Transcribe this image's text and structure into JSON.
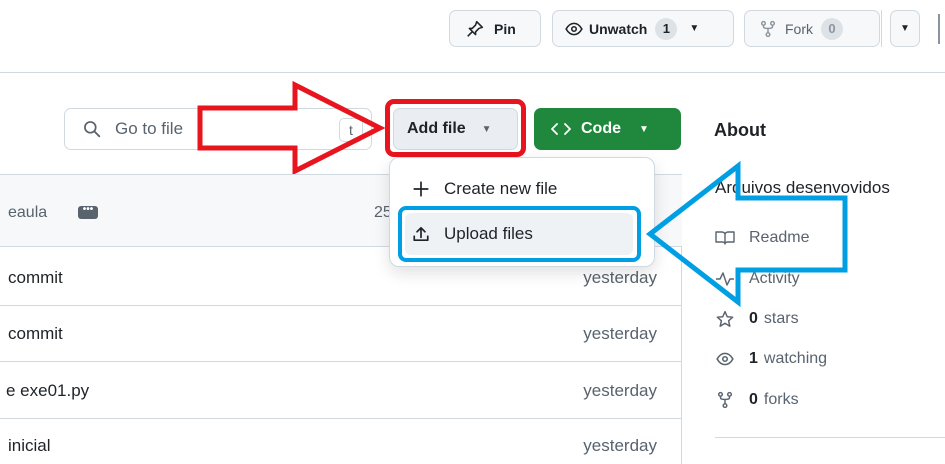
{
  "header": {
    "pin_label": "Pin",
    "unwatch_label": "Unwatch",
    "unwatch_count": "1",
    "fork_label": "Fork",
    "fork_count": "0"
  },
  "toolbar": {
    "search_placeholder": "Go to file",
    "search_shortcut": "t",
    "add_file_label": "Add file",
    "code_label": "Code"
  },
  "add_file_menu": {
    "items": [
      {
        "label": "Create new file"
      },
      {
        "label": "Upload files"
      }
    ]
  },
  "file_list": {
    "header_text": "eaula",
    "header_date": "25",
    "rows": [
      {
        "message": "commit",
        "date": "yesterday"
      },
      {
        "message": "commit",
        "date": "yesterday"
      },
      {
        "message": "e exe01.py",
        "date": "yesterday"
      },
      {
        "message": "inicial",
        "date": "yesterday"
      }
    ]
  },
  "about": {
    "title": "About",
    "description": "Arquivos desenvovidos",
    "readme_label": "Readme",
    "activity_label": "Activity",
    "stars_count": "0",
    "stars_label": "stars",
    "watching_count": "1",
    "watching_label": "watching",
    "forks_count": "0",
    "forks_label": "forks"
  },
  "colors": {
    "code_button": "#1f883d",
    "highlight_red": "#e8141e",
    "highlight_blue": "#009fe3"
  }
}
